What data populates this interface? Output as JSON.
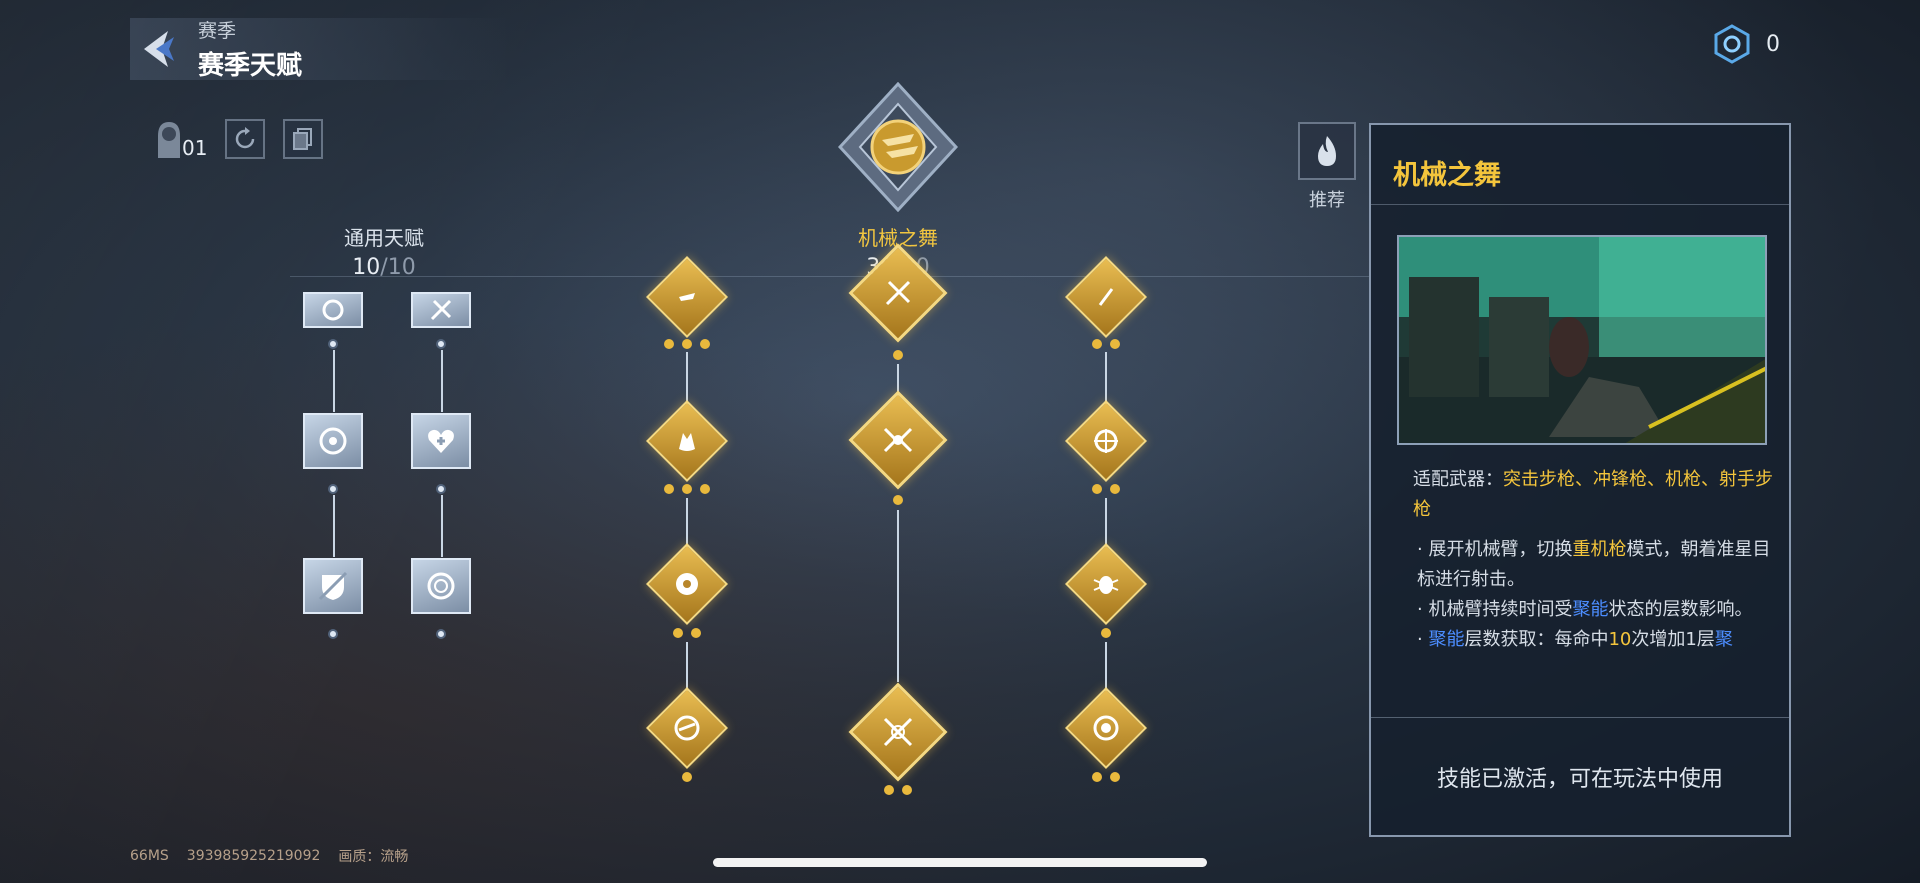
{
  "header": {
    "subtitle": "赛季",
    "title": "赛季天赋"
  },
  "currency": {
    "icon": "season-point-icon",
    "value": "0"
  },
  "toolbar": {
    "slot_icon": "operator-slot-icon",
    "slot_number": "01",
    "reset_icon": "reset-icon",
    "copy_icon": "copy-icon"
  },
  "categories": [
    {
      "name": "通用天赋",
      "current": "10",
      "max": "/10"
    },
    {
      "name": "机械之舞",
      "current": "30",
      "max": "/30"
    }
  ],
  "recommend": {
    "icon": "fire-icon",
    "label": "推荐"
  },
  "panel": {
    "title": "机械之舞",
    "weapons_label": "适配武器：",
    "weapons_value": "突击步枪、冲锋枪、机枪、射手步枪",
    "desc1_a": "· 展开机械臂，切换",
    "desc1_hl": "重机枪",
    "desc1_b": "模式，朝着准星目标进行射击。",
    "desc2_a": "· 机械臂持续时间受",
    "desc2_hl": "聚能",
    "desc2_b": "状态的层数影响。",
    "desc3_prefix": "· ",
    "desc3_hl1": "聚能",
    "desc3_a": "层数获取：每命中",
    "desc3_num": "10",
    "desc3_b": "次增加1层",
    "desc3_hl2": "聚",
    "status": "技能已激活，可在玩法中使用"
  },
  "footer": {
    "ping": "66MS",
    "id": "393985925219092",
    "quality": "画质：流畅"
  },
  "colors": {
    "gold": "#f4c53c",
    "blue": "#4c8dff",
    "panel_bg": "#16202e"
  }
}
